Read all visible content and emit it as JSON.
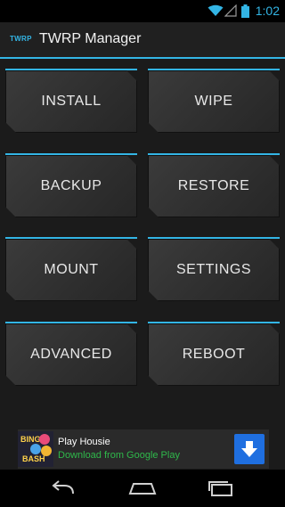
{
  "status": {
    "time": "1:02"
  },
  "app": {
    "logo": "TWRP",
    "title": "TWRP Manager"
  },
  "buttons": {
    "install": "INSTALL",
    "wipe": "WIPE",
    "backup": "BACKUP",
    "restore": "RESTORE",
    "mount": "MOUNT",
    "settings": "SETTINGS",
    "advanced": "ADVANCED",
    "reboot": "REBOOT"
  },
  "ad": {
    "icon_text_top": "BINGO",
    "icon_text_bottom": "BASH",
    "title": "Play Housie",
    "subtitle": "Download from Google Play",
    "icon": "download-icon"
  },
  "colors": {
    "accent": "#33b5e5",
    "ad_link": "#2fb94b",
    "download_button": "#1f6fe0"
  },
  "nav": {
    "icons": [
      "back-icon",
      "home-icon",
      "recents-icon"
    ]
  }
}
